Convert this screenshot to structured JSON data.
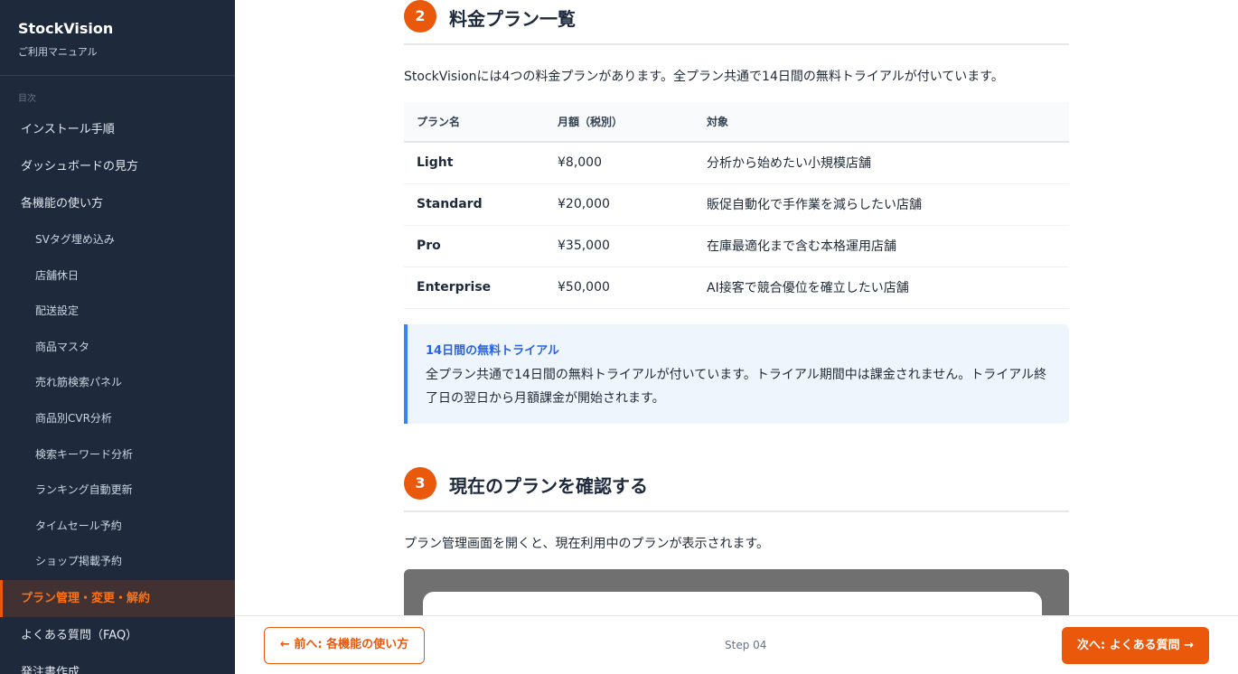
{
  "sidebar": {
    "brand_title": "StockVision",
    "brand_subtitle": "ご利用マニュアル",
    "toc_label": "目次",
    "items": [
      {
        "label": "インストール手順"
      },
      {
        "label": "ダッシュボードの見方"
      },
      {
        "label": "各機能の使い方"
      },
      {
        "label": "SVタグ埋め込み"
      },
      {
        "label": "店舗休日"
      },
      {
        "label": "配送設定"
      },
      {
        "label": "商品マスタ"
      },
      {
        "label": "売れ筋検索パネル"
      },
      {
        "label": "商品別CVR分析"
      },
      {
        "label": "検索キーワード分析"
      },
      {
        "label": "ランキング自動更新"
      },
      {
        "label": "タイムセール予約"
      },
      {
        "label": "ショップ掲載予約"
      },
      {
        "label": "プラン管理・変更・解約"
      },
      {
        "label": "よくある質問（FAQ）"
      },
      {
        "label": "発注書作成"
      }
    ]
  },
  "section2": {
    "number": "2",
    "title": "料金プラン一覧",
    "intro": "StockVisionには4つの料金プランがあります。全プラン共通で14日間の無料トライアルが付いています。",
    "table": {
      "headers": [
        "プラン名",
        "月額（税別）",
        "対象"
      ],
      "rows": [
        [
          "Light",
          "¥8,000",
          "分析から始めたい小規模店舗"
        ],
        [
          "Standard",
          "¥20,000",
          "販促自動化で手作業を減らしたい店舗"
        ],
        [
          "Pro",
          "¥35,000",
          "在庫最適化まで含む本格運用店舗"
        ],
        [
          "Enterprise",
          "¥50,000",
          "AI接客で競合優位を確立したい店舗"
        ]
      ]
    },
    "callout": {
      "title": "14日間の無料トライアル",
      "body_line1": "全プラン共通で14日間の無料トライアルが付いています。トライアル期間中は課金されません。トライアル終",
      "body_line2": "了日の翌日から月額課金が開始されます。"
    }
  },
  "section3": {
    "number": "3",
    "title": "現在のプランを確認する",
    "intro": "プラン管理画面を開くと、現在利用中のプランが表示されます。"
  },
  "footer": {
    "prev_label": "← 前へ: 各機能の使い方",
    "step_label": "Step 04",
    "next_label": "次へ: よくある質問 →"
  },
  "colors": {
    "accent": "#ea580c",
    "sidebar_bg": "#1e293b",
    "callout_accent": "#3b82f6"
  }
}
